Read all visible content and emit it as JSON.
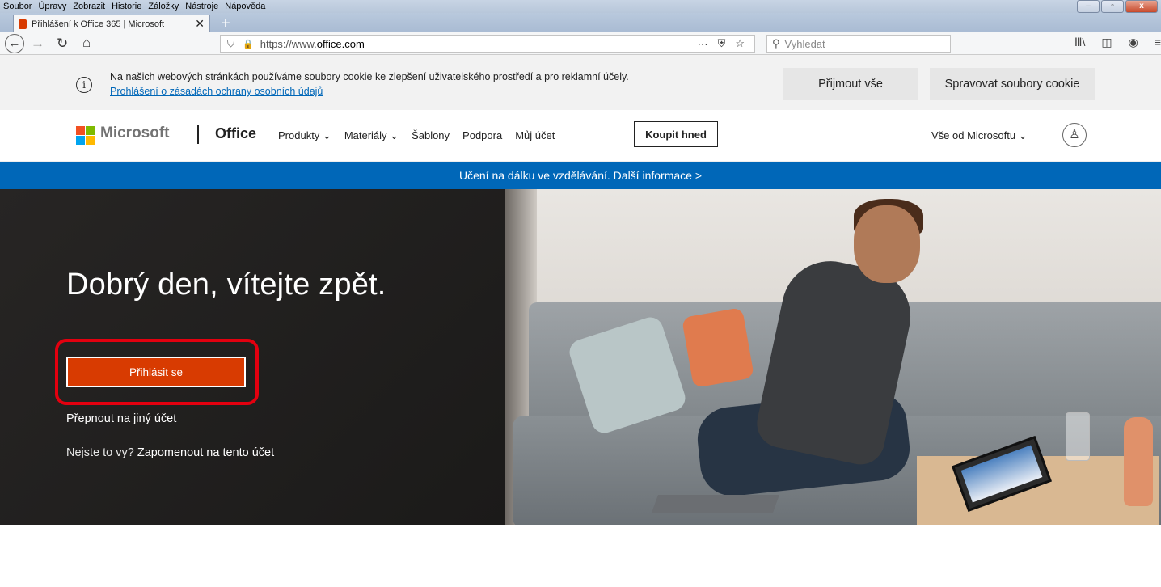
{
  "menubar": {
    "items": [
      "Soubor",
      "Úpravy",
      "Zobrazit",
      "Historie",
      "Záložky",
      "Nástroje",
      "Nápověda"
    ]
  },
  "tab": {
    "title": "Přihlášení k Office 365 | Microsoft",
    "close": "✕",
    "new_tab": "+"
  },
  "navbar": {
    "url_prefix": "https://www.",
    "url_domain": "office.com",
    "search_placeholder": "Vyhledat"
  },
  "cookie": {
    "text": "Na našich webových stránkách používáme soubory cookie ke zlepšení uživatelského prostředí a pro reklamní účely.",
    "link": "Prohlášení o zásadách ochrany osobních údajů",
    "accept": "Přijmout vše",
    "manage": "Spravovat soubory cookie"
  },
  "header": {
    "microsoft": "Microsoft",
    "office": "Office",
    "nav": [
      "Produkty ⌄",
      "Materiály ⌄",
      "Šablony",
      "Podpora",
      "Můj účet"
    ],
    "buy": "Koupit hned",
    "all_microsoft": "Vše od Microsoftu ⌄"
  },
  "banner": {
    "text": "Učení na dálku ve vzdělávání. Další informace >"
  },
  "hero": {
    "title": "Dobrý den, vítejte zpět.",
    "signin": "Přihlásit se",
    "switch": "Přepnout na jiný účet",
    "not_you": "Nejste to vy?",
    "forget": "Zapomenout na tento účet"
  },
  "colors": {
    "brand_blue": "#0067b8",
    "signin_orange": "#d83b01",
    "highlight_red": "#e3000f"
  }
}
